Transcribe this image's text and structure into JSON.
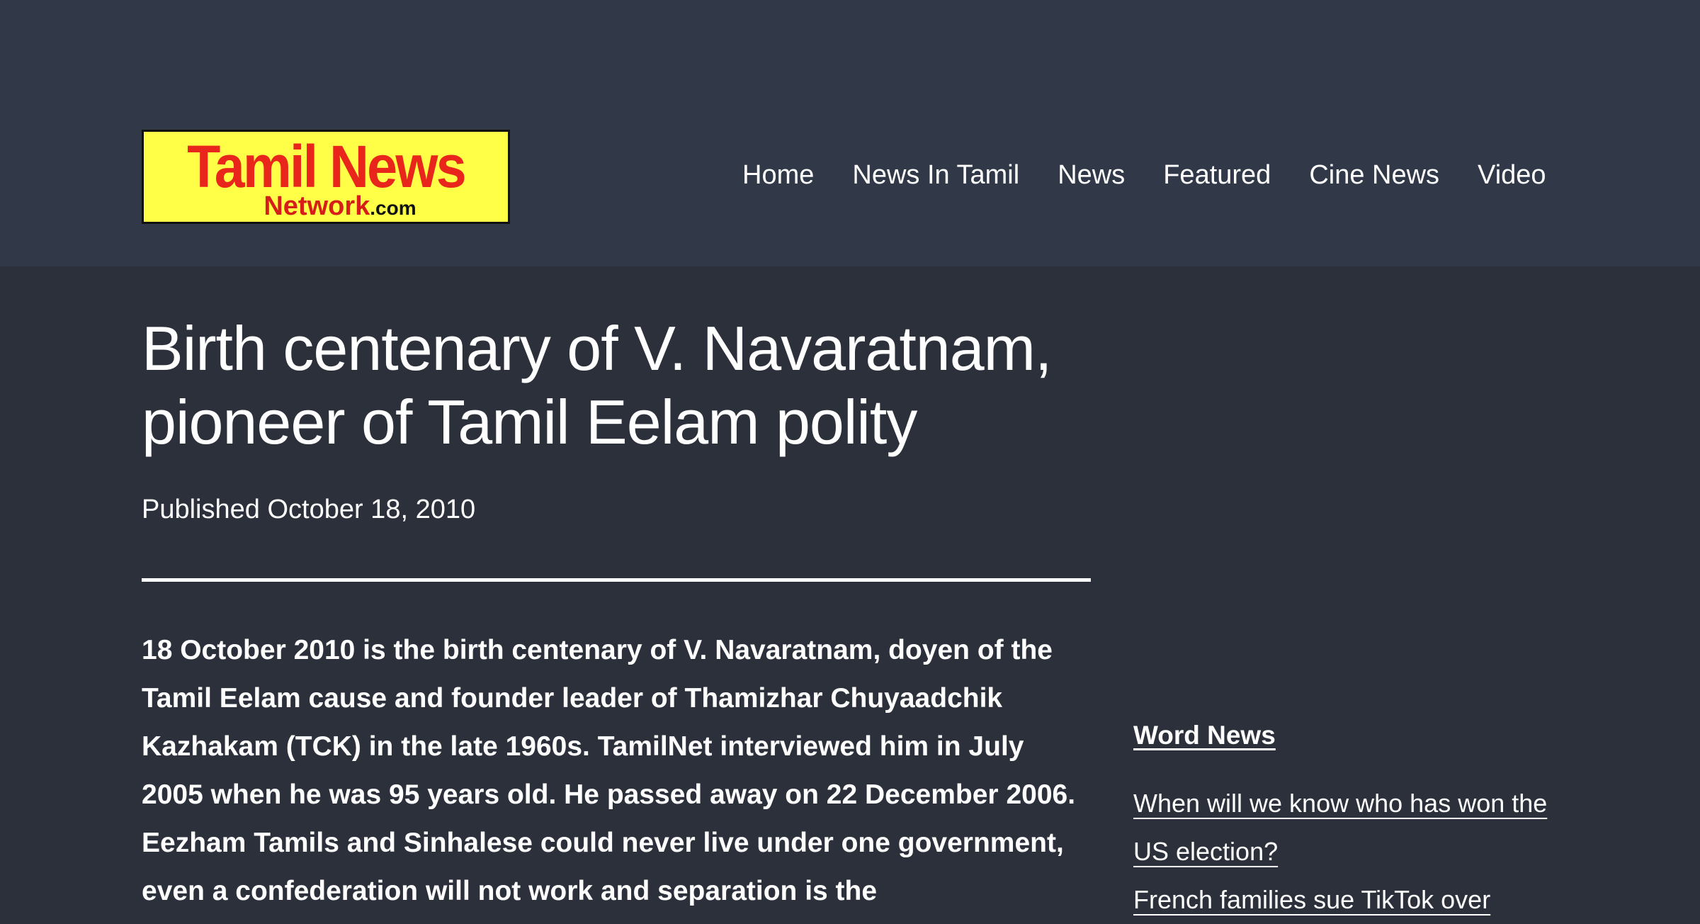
{
  "header": {
    "logo": {
      "main_text": "Tamil News",
      "sub_text": "Network",
      "tld_text": ".com",
      "background_color": "#ffff47",
      "text_color": "#e8261c"
    },
    "nav": [
      {
        "label": "Home"
      },
      {
        "label": "News In Tamil"
      },
      {
        "label": "News"
      },
      {
        "label": "Featured"
      },
      {
        "label": "Cine News"
      },
      {
        "label": "Video"
      }
    ]
  },
  "article": {
    "title": "Birth centenary of V. Navaratnam, pioneer of Tamil Eelam polity",
    "published": "Published October 18, 2010",
    "lead": "18 October 2010 is the birth centenary of V. Navaratnam, doyen of the Tamil Eelam cause and founder leader of Thamizhar Chuyaadchik Kazhakam (TCK) in the late 1960s. TamilNet interviewed him in July 2005 when he was 95 years old. He passed away on 22 December 2006. Eezham Tamils and Sinhalese could never live under one government, even a confederation will not work and separation is the"
  },
  "sidebar": {
    "title": "Word News",
    "links": [
      {
        "label": "When will we know who has won the US election?"
      },
      {
        "label": "French families sue TikTok over"
      }
    ]
  },
  "colors": {
    "header_background": "#313949",
    "page_background": "#2b303b",
    "text": "#ffffff"
  }
}
